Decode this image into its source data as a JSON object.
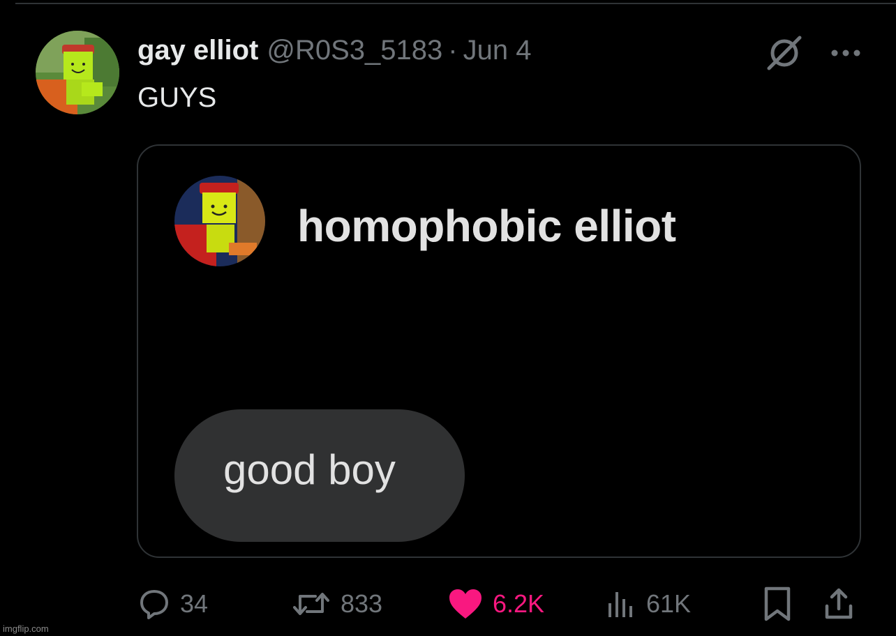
{
  "tweet": {
    "display_name": "gay elliot",
    "handle": "@R0S3_5183",
    "separator": "·",
    "date": "Jun 4",
    "text": "GUYS"
  },
  "media": {
    "inner_name": "homophobic elliot",
    "bubble_text": "good boy"
  },
  "actions": {
    "replies": "34",
    "reposts": "833",
    "likes": "6.2K",
    "views": "61K"
  },
  "watermark": "imgflip.com",
  "colors": {
    "background": "#000000",
    "text": "#e7e9ea",
    "muted": "#71767b",
    "like": "#f91880",
    "border": "#2f3336",
    "bubble": "#303132"
  },
  "icons": {
    "reply": "speech-bubble-icon",
    "repost": "repost-icon",
    "like": "heart-icon",
    "views": "bar-chart-icon",
    "bookmark": "bookmark-icon",
    "share": "share-icon",
    "grok": "grok-icon",
    "more": "more-dots-icon"
  }
}
